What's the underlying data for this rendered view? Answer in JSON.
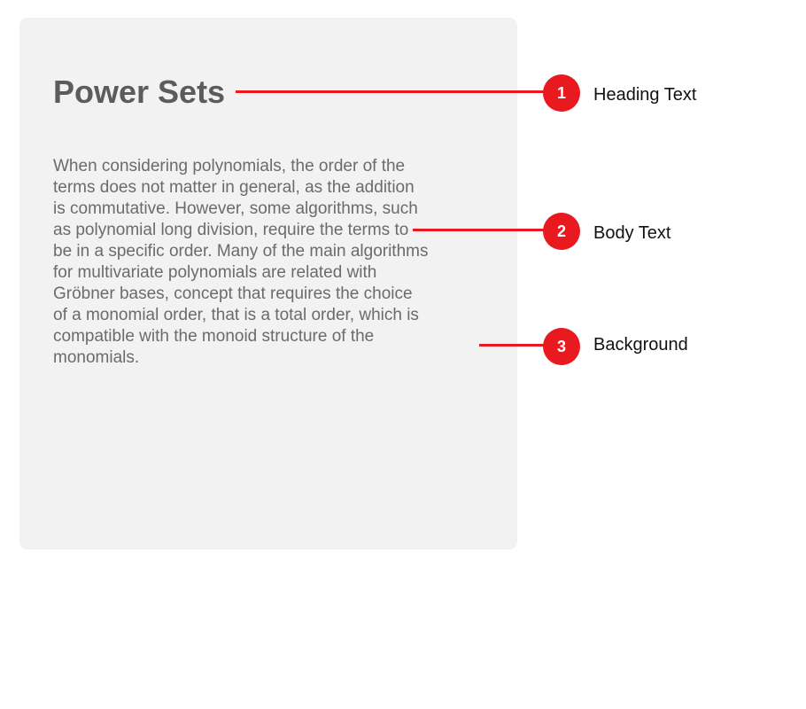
{
  "card": {
    "heading": "Power Sets",
    "body": "When considering polynomials, the order of the terms does not matter in general, as the addition is commutative. However, some algorithms, such as polynomial long division, require the terms to be in a specific order. Many of the main algorithms for multivariate polynomials are related with Gröbner bases, concept that requires the choice of a monomial order, that is a total order, which is compatible with the monoid structure of the monomials."
  },
  "callouts": [
    {
      "number": "1",
      "label": "Heading Text"
    },
    {
      "number": "2",
      "label": "Body Text"
    },
    {
      "number": "3",
      "label": "Background"
    }
  ],
  "colors": {
    "callout_accent": "#e8191f",
    "card_background": "#f2f2f2",
    "heading_text": "#5c5c5c",
    "body_text": "#6b6b6b"
  }
}
